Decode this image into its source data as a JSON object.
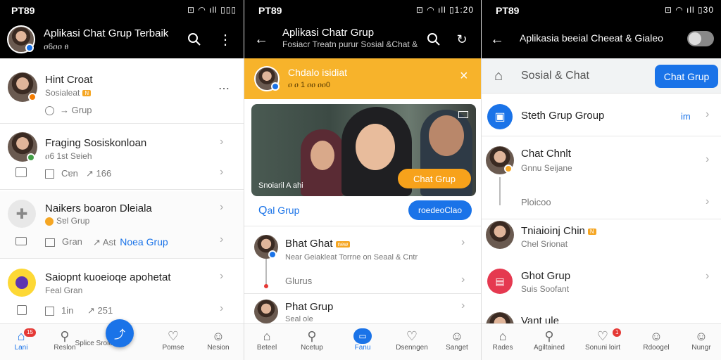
{
  "panel1": {
    "status": {
      "carrier": "PT89",
      "icons": "⊡ ◠ ıll ▯▯▯"
    },
    "header": {
      "title": "Aplikasi Chat Grup Terbaik",
      "subtitle": "ዐ6ዐዐ ፀ"
    },
    "rows": [
      {
        "name": "Hint Croat",
        "meta1": "Sosialeat",
        "badge": "N",
        "meta2": "Grup",
        "trailing": "⋯"
      },
      {
        "name": "Fraging Sosiskonloan",
        "meta1": "ዐ6 1st Sɐieh",
        "stat1": "Cɐn",
        "stat2": "166"
      },
      {
        "name": "Naikers boaron Dleiala",
        "meta1": "Sɐl Grup",
        "stat1": "Gran",
        "stat2": "Ast",
        "link": "Noea Grup"
      },
      {
        "name": "Saiopnt kuoeioqe apohetat",
        "meta1": "Feal Gran",
        "stat1": "1in",
        "stat2": "251"
      }
    ],
    "nav": [
      {
        "label": "Lani",
        "badge": "15"
      },
      {
        "label": "Reslon"
      },
      {
        "label": "Splice Sroion"
      },
      {
        "label": "Pomse"
      },
      {
        "label": "Nesion"
      }
    ]
  },
  "panel2": {
    "status": {
      "carrier": "PT89",
      "icons": "⊡ ◠ ıll ▯1:20"
    },
    "header": {
      "title": "Aplikasi Chatr Grup",
      "subtitle": "Fosiacr Treatn purur Sosial &Chat &"
    },
    "banner": {
      "name": "Chdalo isidiat",
      "meta": "ዐ ዐ 1 ዐዐ ዐዐ0",
      "close": "×"
    },
    "photo": {
      "caption": "Snoiaril A ahi",
      "cta": "Chat Grup"
    },
    "search": {
      "label": "al Grup",
      "button": "roedeoClao"
    },
    "list": [
      {
        "name": "Bhat Ghat",
        "tag": "new",
        "meta": "Near Geiakleat Torrne on Seaal & Cntr"
      },
      {
        "name": "Glurus"
      },
      {
        "name": "Phat Grup",
        "meta": "Seal ole"
      }
    ],
    "nav": [
      {
        "label": "Beteel"
      },
      {
        "label": "Ncetup"
      },
      {
        "label": "Fanu"
      },
      {
        "label": "Dsenngen"
      },
      {
        "label": "Sanget"
      }
    ]
  },
  "panel3": {
    "status": {
      "carrier": "PT89",
      "icons": "⊡ ◠ ıll ▯30"
    },
    "header": {
      "title": "Aplikasia beeial Cheeat & Gialeo"
    },
    "subheader": {
      "label": "Sosial & Chat",
      "button": "Chat Grup"
    },
    "list": [
      {
        "name": "Steth Grup Group",
        "trailing": "im"
      },
      {
        "name": "Chat Chnlt",
        "meta": "Gnnu Seijane"
      },
      {
        "name": "Ploicoo"
      },
      {
        "name": "Tniaioinj Chin",
        "tag": "N",
        "meta": "Chel Srionat"
      },
      {
        "name": "Ghot Grup",
        "meta": "Suis Soofant"
      },
      {
        "name": "Vant ule"
      }
    ],
    "nav": [
      {
        "label": "Rades"
      },
      {
        "label": "Agiltained"
      },
      {
        "label": "Sonuni loirt",
        "badge": "1"
      },
      {
        "label": "Rdoogel"
      },
      {
        "label": "Nungr"
      }
    ]
  }
}
